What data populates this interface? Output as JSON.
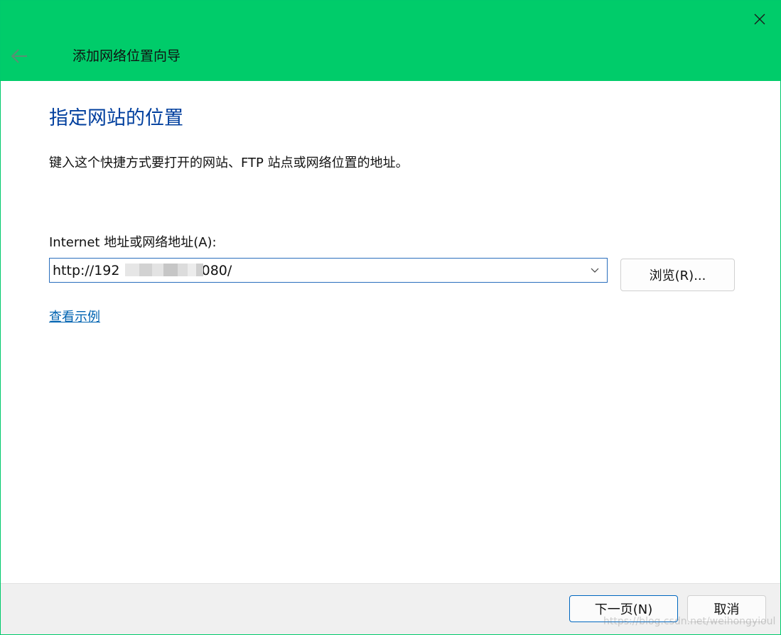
{
  "window": {
    "title": "添加网络位置向导",
    "accent_color": "#00cc6a",
    "icons": {
      "close": "close-icon",
      "back": "arrow-left-icon",
      "dropdown": "chevron-down-icon"
    }
  },
  "main": {
    "heading": "指定网站的位置",
    "description": "键入这个快捷方式要打开的网站、FTP 站点或网络位置的地址。",
    "address_label": "Internet 地址或网络地址(A):",
    "address_value": "http://192              7:8080/",
    "browse_label": "浏览(R)...",
    "example_link": "查看示例"
  },
  "footer": {
    "next_label": "下一页(N)",
    "cancel_label": "取消"
  },
  "watermark": "https://blog.csdn.net/weihongyioul"
}
